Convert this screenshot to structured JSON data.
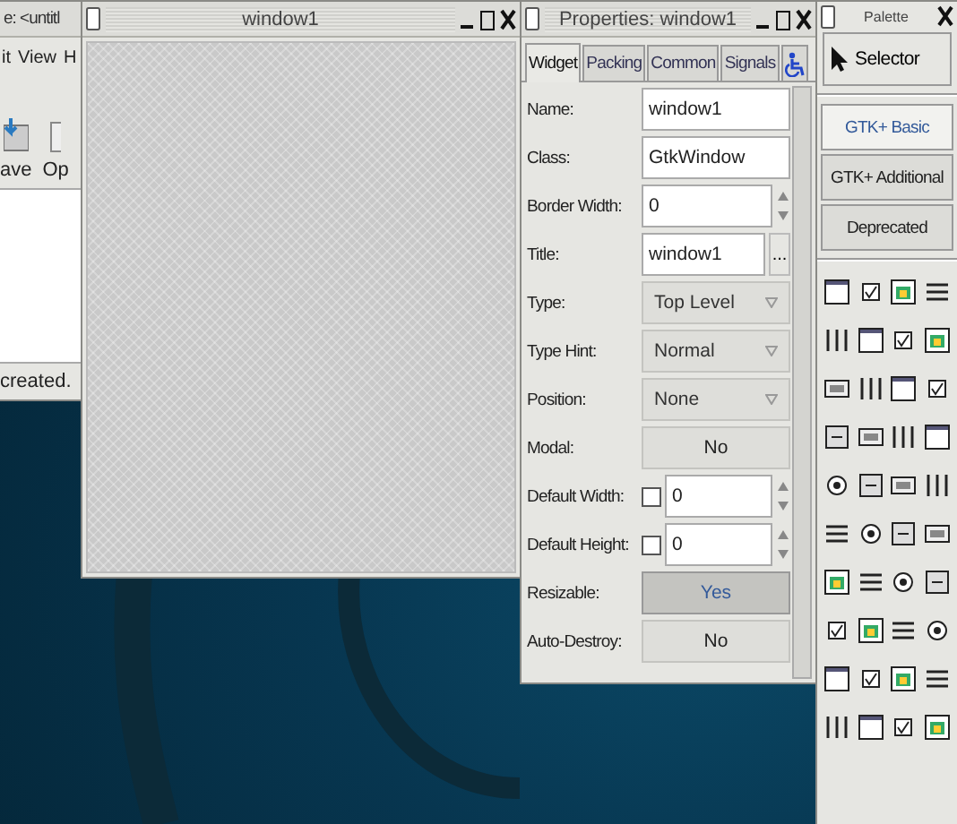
{
  "back_window": {
    "title": "e: <untitl",
    "menu": [
      "it",
      "View",
      "H"
    ],
    "toolbar": [
      {
        "label": "ave"
      },
      {
        "label": "Op"
      }
    ],
    "status": "created."
  },
  "design_window": {
    "title": "window1"
  },
  "properties": {
    "title": "Properties: window1",
    "tabs": [
      {
        "label": "Widget",
        "selected": true
      },
      {
        "label": "Packing",
        "selected": false
      },
      {
        "label": "Common",
        "selected": false
      },
      {
        "label": "Signals",
        "selected": false
      }
    ],
    "accessibility_tab": {
      "selected": false
    },
    "rows": [
      {
        "label": "Name:",
        "kind": "entry",
        "value": "window1"
      },
      {
        "label": "Class:",
        "kind": "entry",
        "value": "GtkWindow"
      },
      {
        "label": "Border Width:",
        "kind": "spin",
        "value": "0"
      },
      {
        "label": "Title:",
        "kind": "entry_button",
        "value": "window1",
        "button": "..."
      },
      {
        "label": "Type:",
        "kind": "combo",
        "value": "Top Level"
      },
      {
        "label": "Type Hint:",
        "kind": "combo",
        "value": "Normal"
      },
      {
        "label": "Position:",
        "kind": "combo",
        "value": "None"
      },
      {
        "label": "Modal:",
        "kind": "toggle",
        "value": "No",
        "active": false
      },
      {
        "label": "Default Width:",
        "kind": "check_spin",
        "checked": false,
        "value": "0"
      },
      {
        "label": "Default Height:",
        "kind": "check_spin",
        "checked": false,
        "value": "0"
      },
      {
        "label": "Resizable:",
        "kind": "toggle",
        "value": "Yes",
        "active": true
      },
      {
        "label": "Auto-Destroy:",
        "kind": "toggle",
        "value": "No",
        "active": false
      }
    ]
  },
  "palette": {
    "title": "Palette",
    "selector": "Selector",
    "groups": [
      {
        "label": "GTK+ Basic",
        "selected": true
      },
      {
        "label": "GTK+ Additional",
        "selected": false
      },
      {
        "label": "Deprecated",
        "selected": false
      }
    ]
  }
}
